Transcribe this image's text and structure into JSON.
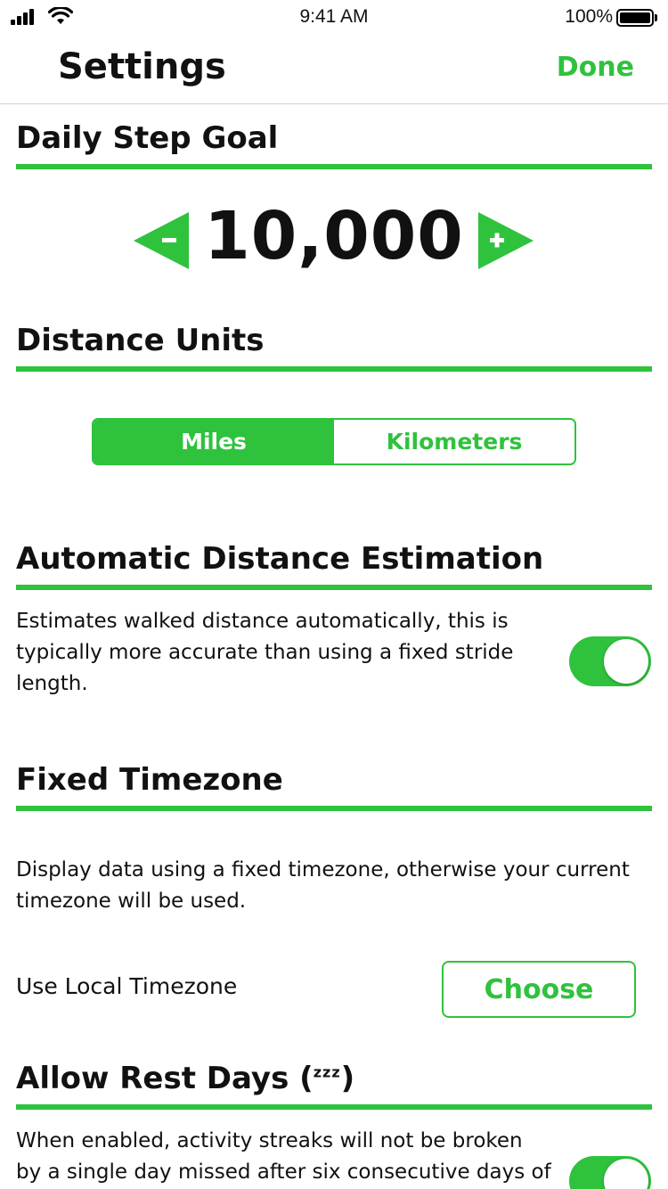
{
  "status_bar": {
    "time": "9:41 AM",
    "battery_percent": "100%",
    "icons": [
      "cellular-signal-icon",
      "wifi-icon",
      "battery-icon"
    ]
  },
  "nav": {
    "title": "Settings",
    "done_label": "Done"
  },
  "colors": {
    "accent": "#2fc23d",
    "text": "#111111",
    "background": "#ffffff"
  },
  "daily_step_goal": {
    "heading": "Daily Step Goal",
    "value": "10,000",
    "decrement_symbol": "−",
    "increment_symbol": "+"
  },
  "distance_units": {
    "heading": "Distance Units",
    "options": [
      "Miles",
      "Kilometers"
    ],
    "selected": "Miles"
  },
  "auto_distance": {
    "heading": "Automatic Distance Estimation",
    "description_lines": [
      "Estimates walked distance automatically, this is",
      "typically more accurate than using a fixed stride",
      "length."
    ],
    "enabled": true
  },
  "fixed_timezone": {
    "heading": "Fixed Timezone",
    "description_lines": [
      "Display data using a fixed timezone, otherwise your current",
      "timezone will be used."
    ],
    "row_label": "Use Local Timezone",
    "choose_label": "Choose"
  },
  "rest_days": {
    "heading": "Allow Rest Days",
    "heading_suffix": "zzz",
    "description_lines": [
      "When enabled, activity streaks will not be broken",
      "by a single day missed after six consecutive days of"
    ],
    "enabled": true
  }
}
